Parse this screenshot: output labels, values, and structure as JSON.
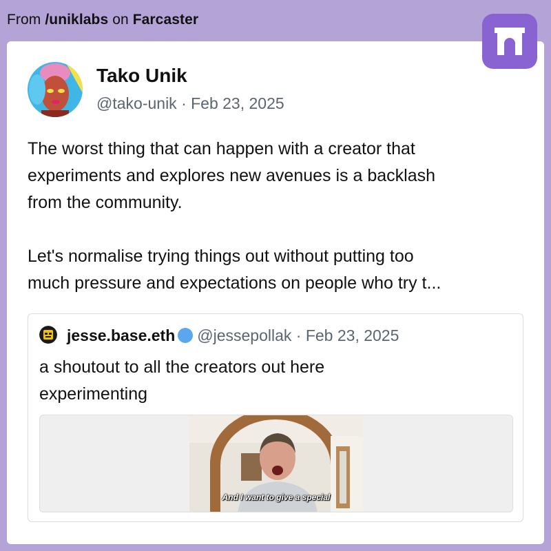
{
  "header": {
    "prefix": "From ",
    "channel": "/uniklabs",
    "middle": " on ",
    "platform": "Farcaster"
  },
  "logo": {
    "icon": "farcaster-arch-icon",
    "color": "#8a63d2"
  },
  "post": {
    "author_name": "Tako Unik",
    "author_meta": "@tako-unik · Feb 23, 2025",
    "lines": [
      "The worst thing that can happen with a creator that",
      "experiments and explores new avenues is a backlash",
      "from the community.",
      "Let's normalise trying things out without putting too",
      "much pressure and expectations on people who try t..."
    ]
  },
  "quote": {
    "author_name": "jesse.base.eth",
    "verified_icon": "verified-badge-icon",
    "meta": "@jessepollak · Feb 23, 2025",
    "lines": [
      "a shoutout to all the creators out here",
      "experimenting"
    ],
    "video_caption": "And I want to give a special"
  },
  "colors": {
    "background": "#b3a3d6",
    "card": "#ffffff",
    "brand": "#8a63d2",
    "meta_text": "#5b6570",
    "verified": "#5aa7f0"
  }
}
